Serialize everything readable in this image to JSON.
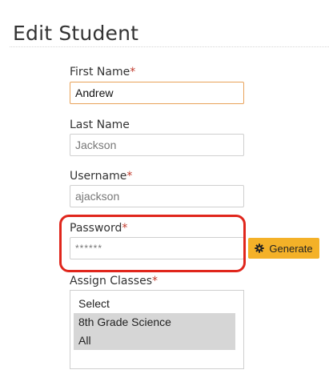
{
  "page": {
    "title": "Edit Student"
  },
  "form": {
    "first_name": {
      "label": "First Name",
      "required_mark": "*",
      "value": "Andrew"
    },
    "last_name": {
      "label": "Last Name",
      "value": "Jackson"
    },
    "username": {
      "label": "Username",
      "required_mark": "*",
      "value": "ajackson"
    },
    "password": {
      "label": "Password",
      "required_mark": "*",
      "value": "******"
    },
    "generate_button": {
      "label": "Generate",
      "icon": "gear-icon"
    },
    "assign_classes": {
      "label": "Assign Classes",
      "required_mark": "*",
      "options": [
        {
          "label": "Select",
          "selected": false
        },
        {
          "label": "8th Grade Science",
          "selected": true
        },
        {
          "label": "All",
          "selected": true
        }
      ]
    }
  },
  "colors": {
    "required": "#c0392b",
    "focus_border": "#e8a25a",
    "generate_bg": "#f4b128",
    "highlight_ring": "#e0261c",
    "selected_option_bg": "#d6d6d6"
  }
}
